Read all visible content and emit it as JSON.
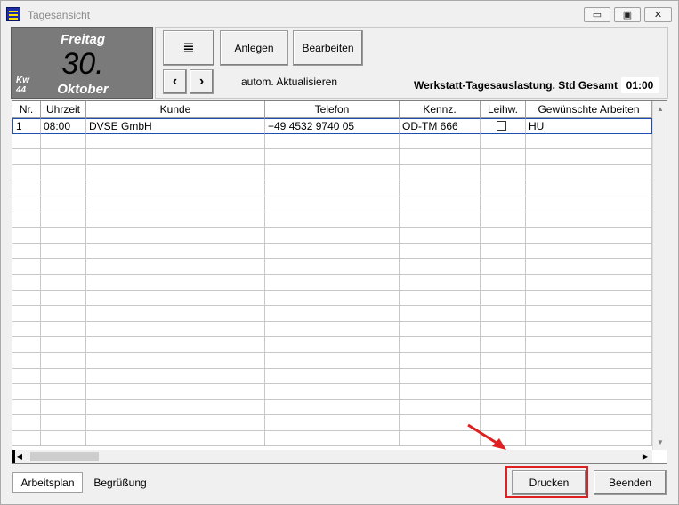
{
  "window": {
    "title": "Tagesansicht",
    "controls": {
      "minimize": "▭",
      "maximize": "▣",
      "close": "✕"
    }
  },
  "date": {
    "weekday": "Freitag",
    "day": "30.",
    "month": "Oktober",
    "kw_label": "Kw",
    "kw_number": "44"
  },
  "toolbar": {
    "list_icon": "≣",
    "anlegen_label": "Anlegen",
    "bearbeiten_label": "Bearbeiten",
    "prev_icon": "‹",
    "next_icon": "›",
    "auto_refresh": "autom. Aktualisieren",
    "load_label": "Werkstatt-Tagesauslastung. Std Gesamt",
    "load_value": "01:00"
  },
  "grid": {
    "columns": [
      "Nr.",
      "Uhrzeit",
      "Kunde",
      "Telefon",
      "Kennz.",
      "Leihw.",
      "Gewünschte Arbeiten"
    ],
    "rows": [
      {
        "nr": "1",
        "uhrzeit": "08:00",
        "kunde": "DVSE GmbH",
        "telefon": "+49 4532 9740 05",
        "kennz": "OD-TM 666",
        "leihw": false,
        "arbeiten": "HU"
      }
    ],
    "empty_rows": 20
  },
  "tabs": {
    "arbeitsplan": "Arbeitsplan",
    "begruessung": "Begrüßung"
  },
  "buttons": {
    "drucken": "Drucken",
    "beenden": "Beenden"
  },
  "colors": {
    "highlight": "#e02020",
    "date_tile": "#7a7a7a",
    "active_row": "#1c4fb0"
  }
}
